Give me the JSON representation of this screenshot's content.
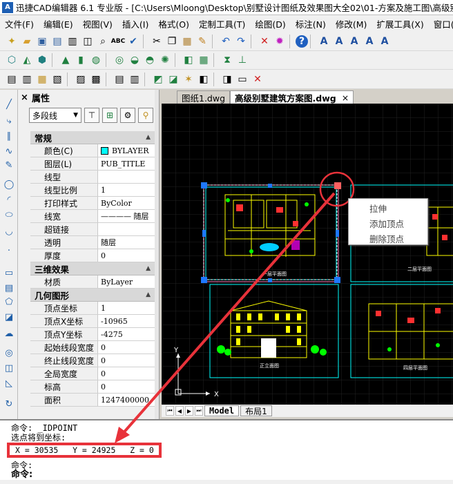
{
  "window": {
    "title": "迅捷CAD编辑器 6.1 专业版 - [C:\\Users\\Mloong\\Desktop\\别墅设计图纸及效果图大全02\\01-方案及施工图\\高级别墅"
  },
  "menu": [
    "文件(F)",
    "编辑(E)",
    "视图(V)",
    "插入(I)",
    "格式(O)",
    "定制工具(T)",
    "绘图(D)",
    "标注(N)",
    "修改(M)",
    "扩展工具(X)",
    "窗口(W)"
  ],
  "properties": {
    "title": "属性",
    "close_glyph": "×",
    "entity_type": "多段线",
    "sections": [
      {
        "label": "常规",
        "rows": [
          {
            "k": "颜色(C)",
            "v": "BYLAYER",
            "swatch": "#00ffff"
          },
          {
            "k": "图层(L)",
            "v": "PUB_TITLE"
          },
          {
            "k": "线型",
            "v": ""
          },
          {
            "k": "线型比例",
            "v": "1"
          },
          {
            "k": "打印样式",
            "v": "ByColor"
          },
          {
            "k": "线宽",
            "v": "———— 随层"
          },
          {
            "k": "超链接",
            "v": ""
          },
          {
            "k": "透明",
            "v": "随层"
          },
          {
            "k": "厚度",
            "v": "0"
          }
        ]
      },
      {
        "label": "三维效果",
        "rows": [
          {
            "k": "材质",
            "v": "ByLayer"
          }
        ]
      },
      {
        "label": "几何图形",
        "rows": [
          {
            "k": "顶点坐标",
            "v": "1"
          },
          {
            "k": "顶点X坐标",
            "v": "-10965"
          },
          {
            "k": "顶点Y坐标",
            "v": "-4275"
          },
          {
            "k": "起始线段宽度",
            "v": "0"
          },
          {
            "k": "终止线段宽度",
            "v": "0"
          },
          {
            "k": "全局宽度",
            "v": "0"
          },
          {
            "k": "标高",
            "v": "0"
          },
          {
            "k": "面积",
            "v": "1247400000"
          }
        ]
      }
    ]
  },
  "tabs": [
    {
      "label": "图纸1.dwg",
      "active": false
    },
    {
      "label": "高级别墅建筑方案图.dwg",
      "active": true
    }
  ],
  "tab_close_glyph": "×",
  "context_menu": [
    "拉伸",
    "添加顶点",
    "删除顶点"
  ],
  "drawing": {
    "labels": [
      "一层平面图",
      "二层平面图",
      "正立面图",
      "四层平面图"
    ],
    "axis_x": "X",
    "axis_y": "Y"
  },
  "layout_tabs": [
    {
      "label": "Model",
      "active": true
    },
    {
      "label": "布局1",
      "active": false
    }
  ],
  "command": {
    "line1": "命令: _IDPOINT",
    "line2": "选点将到坐标:",
    "coords": "X = 30535   Y = 24925   Z = 0",
    "line3": "命令:",
    "prompt": "命令:"
  },
  "colors": {
    "highlight_red": "#e8323a",
    "cad_cyan": "#00ffff",
    "grip_blue": "#1e78ff",
    "canvas_bg": "#000000"
  }
}
